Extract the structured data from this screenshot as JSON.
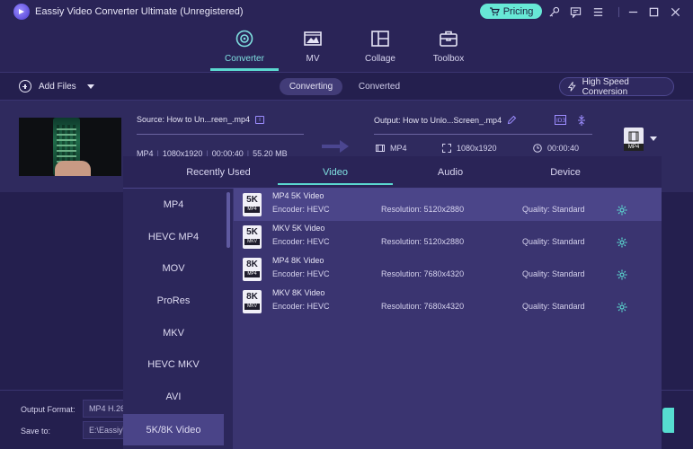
{
  "window": {
    "title": "Eassiy Video Converter Ultimate (Unregistered)",
    "pricing_label": "Pricing"
  },
  "nav": {
    "items": [
      {
        "label": "Converter",
        "icon": "converter-icon",
        "active": true
      },
      {
        "label": "MV",
        "icon": "mv-icon"
      },
      {
        "label": "Collage",
        "icon": "collage-icon"
      },
      {
        "label": "Toolbox",
        "icon": "toolbox-icon"
      }
    ]
  },
  "toolbar": {
    "add_files": "Add Files",
    "tab_converting": "Converting",
    "tab_converted": "Converted",
    "high_speed": "High Speed Conversion"
  },
  "file": {
    "source": "Source: How to Un...reen_.mp4",
    "format": "MP4",
    "resolution": "1080x1920",
    "duration": "00:00:40",
    "size": "55.20 MB",
    "output": "Output: How to Unlo...Screen_.mp4",
    "out_format": "MP4",
    "out_resolution": "1080x1920",
    "out_duration": "00:00:40",
    "badge_format": "MP4"
  },
  "bottom": {
    "output_format_label": "Output Format:",
    "output_format_value": "MP4 H.26",
    "save_to_label": "Save to:",
    "save_to_value": "E:\\Eassiy\\"
  },
  "panel": {
    "tabs": [
      "Recently Used",
      "Video",
      "Audio",
      "Device"
    ],
    "active_tab": "Video",
    "formats": [
      "MP4",
      "HEVC MP4",
      "MOV",
      "ProRes",
      "MKV",
      "HEVC MKV",
      "AVI",
      "5K/8K Video"
    ],
    "selected_format": "5K/8K Video",
    "presets": [
      {
        "res_badge": "5K",
        "container": "MP4",
        "name": "MP4 5K Video",
        "encoder": "Encoder: HEVC",
        "resolution": "Resolution: 5120x2880",
        "quality": "Quality: Standard"
      },
      {
        "res_badge": "5K",
        "container": "MKV",
        "name": "MKV 5K Video",
        "encoder": "Encoder: HEVC",
        "resolution": "Resolution: 5120x2880",
        "quality": "Quality: Standard"
      },
      {
        "res_badge": "8K",
        "container": "MP4",
        "name": "MP4 8K Video",
        "encoder": "Encoder: HEVC",
        "resolution": "Resolution: 7680x4320",
        "quality": "Quality: Standard"
      },
      {
        "res_badge": "8K",
        "container": "MKV",
        "name": "MKV 8K Video",
        "encoder": "Encoder: HEVC",
        "resolution": "Resolution: 7680x4320",
        "quality": "Quality: Standard"
      }
    ]
  },
  "colors": {
    "accent": "#5bd8d0",
    "background": "#241f4e",
    "panel": "#3a3470",
    "pricing": "#67e8d6"
  }
}
